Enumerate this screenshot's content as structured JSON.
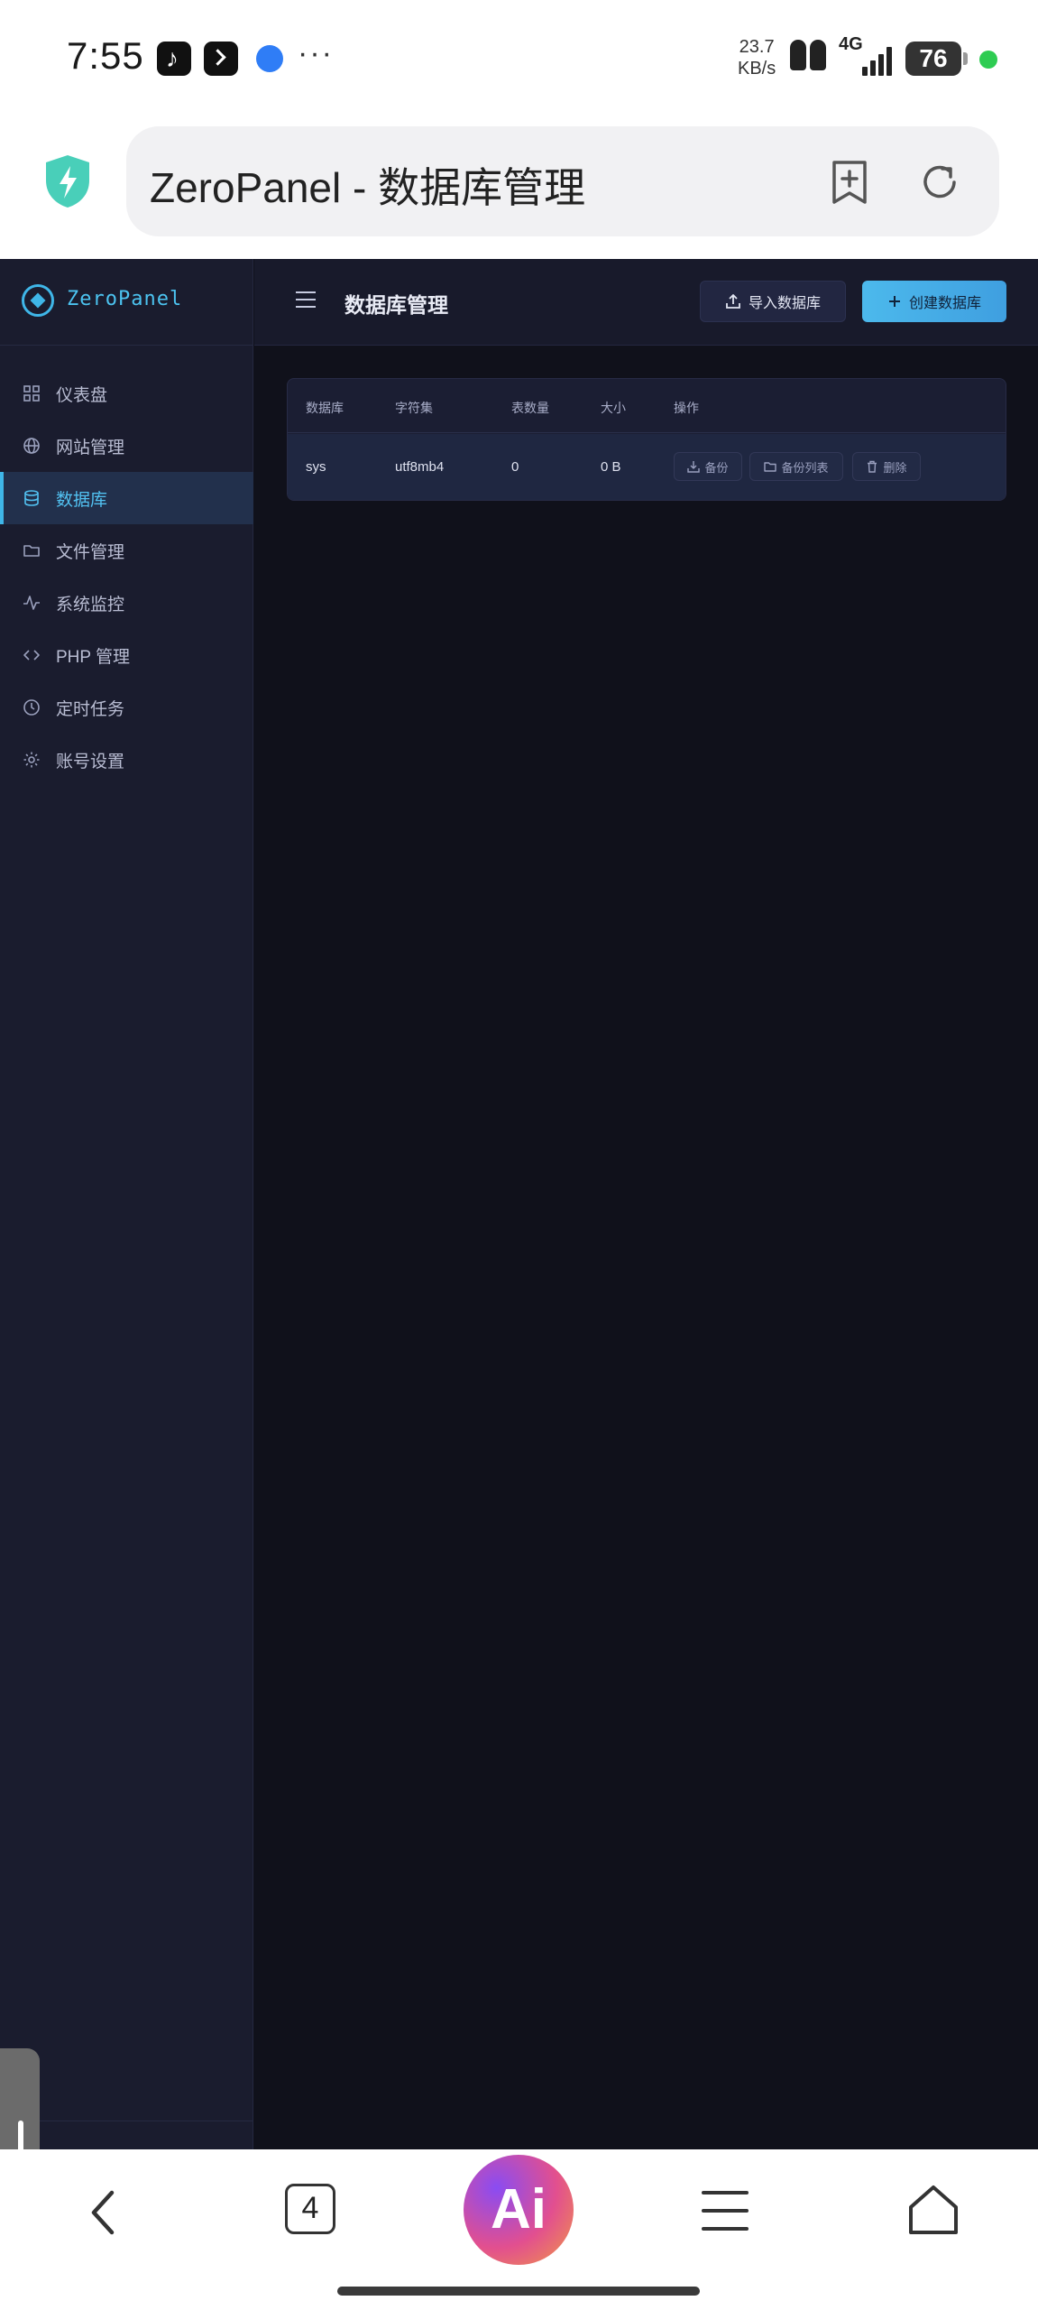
{
  "status_bar": {
    "time": "7:55",
    "overflow": "···",
    "net_speed_value": "23.7",
    "net_speed_unit": "KB/s",
    "network_type": "4G",
    "battery": "76"
  },
  "browser": {
    "url_title": "ZeroPanel - 数据库管理",
    "tab_count": "4",
    "ai_label": "Ai"
  },
  "app": {
    "brand": "ZeroPanel",
    "nav": [
      {
        "label": "仪表盘",
        "icon": "grid-icon"
      },
      {
        "label": "网站管理",
        "icon": "globe-icon"
      },
      {
        "label": "数据库",
        "icon": "database-icon",
        "active": true
      },
      {
        "label": "文件管理",
        "icon": "folder-icon"
      },
      {
        "label": "系统监控",
        "icon": "activity-icon"
      },
      {
        "label": "PHP 管理",
        "icon": "code-icon"
      },
      {
        "label": "定时任务",
        "icon": "clock-icon"
      },
      {
        "label": "账号设置",
        "icon": "gear-icon"
      }
    ],
    "page_title": "数据库管理",
    "import_button": "导入数据库",
    "create_button": "创建数据库",
    "accent_color": "#3fb6e8",
    "table": {
      "headers": [
        "数据库",
        "字符集",
        "表数量",
        "大小",
        "操作"
      ],
      "rows": [
        {
          "name": "sys",
          "charset": "utf8mb4",
          "tables": "0",
          "size": "0 B"
        }
      ],
      "actions": [
        "备份",
        "备份列表",
        "删除"
      ]
    }
  }
}
